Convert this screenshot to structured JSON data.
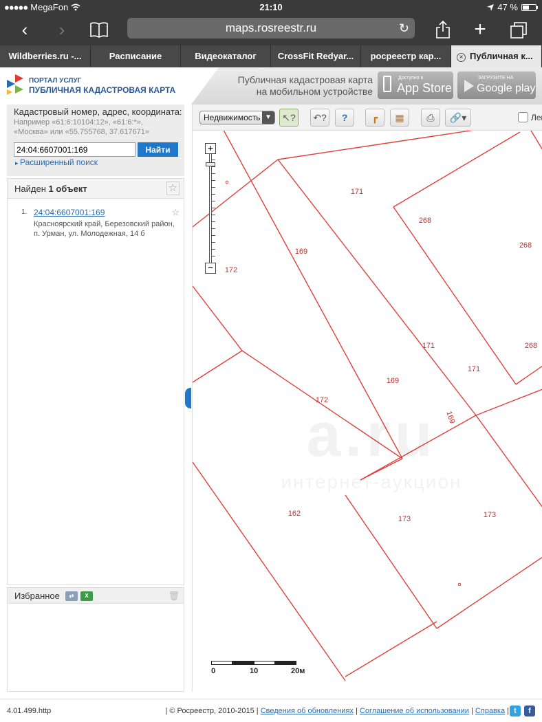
{
  "status_bar": {
    "carrier": "MegaFon",
    "time": "21:10",
    "battery": "47 %"
  },
  "browser": {
    "url": "maps.rosreestr.ru",
    "tabs": [
      {
        "label": "Wildberries.ru -..."
      },
      {
        "label": "Расписание"
      },
      {
        "label": "Видеокаталог"
      },
      {
        "label": "CrossFit Redyar..."
      },
      {
        "label": "росреестр кар..."
      },
      {
        "label": "Публичная к..."
      }
    ]
  },
  "header": {
    "brand_top": "ПОРТАЛ УСЛУГ",
    "brand_title": "ПУБЛИЧНАЯ КАДАСТРОВАЯ КАРТА",
    "mobile_line1": "Публичная кадастровая карта",
    "mobile_line2": "на мобильном устройстве",
    "appstore_small": "Доступно в",
    "appstore_big": "App Store",
    "googleplay_small": "ЗАГРУЗИТЕ НА",
    "googleplay_big": "Google play"
  },
  "search": {
    "label": "Кадастровый номер, адрес, координата:",
    "hint": "Например «61:6:10104:12», «61:6:*», «Москва» или «55.755768, 37.617671»",
    "value": "24:04:6607001:169",
    "button": "Найти",
    "advanced": "Расширенный поиск"
  },
  "results": {
    "prefix": "Найден",
    "count": "1 объект",
    "items": [
      {
        "num": "1.",
        "cadastral": "24:04:6607001:169",
        "address": "Красноярский край, Березовский район, п. Урман, ул. Молодежная, 14 б"
      }
    ]
  },
  "favorites": {
    "label": "Избранное"
  },
  "map": {
    "layer": "Недвижимость",
    "legend_label": "Лег",
    "parcels": [
      "171",
      "268",
      "268",
      "169",
      "172",
      "171",
      "171",
      "268",
      "169",
      "172",
      "169",
      "162",
      "173",
      "173"
    ],
    "scale": {
      "l0": "0",
      "l1": "10",
      "l2": "20м"
    },
    "watermark_big": "a.ru",
    "watermark_small": "интернет-аукцион"
  },
  "footer": {
    "version": "4.01.499.http",
    "copyright": "| © Росреестр, 2010-2015 |",
    "link_updates": "Сведения об обновлениях",
    "link_terms": "Соглашение об использовании",
    "link_help": "Справка",
    "sep": "|"
  },
  "colors": {
    "parcel_line": "#e0403c",
    "accent": "#1f78c8",
    "chrome": "#3a3a3a"
  }
}
